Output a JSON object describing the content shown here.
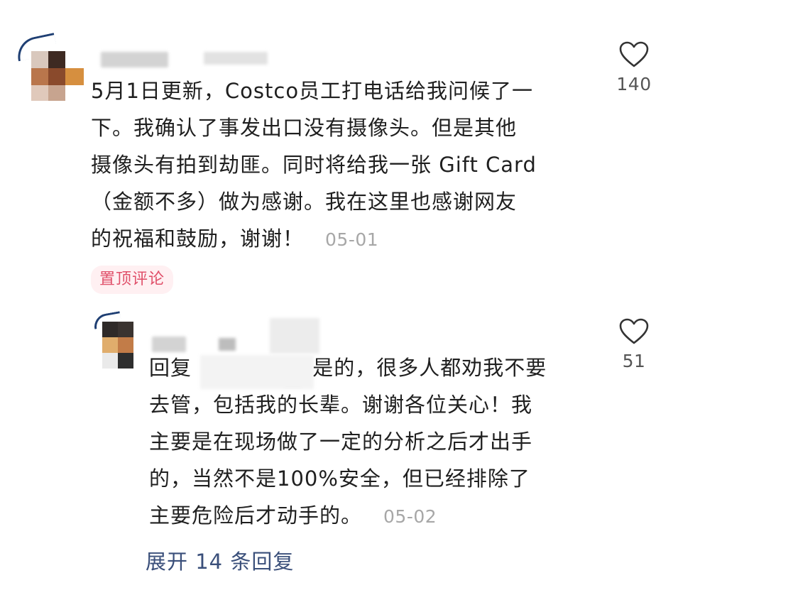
{
  "main_comment": {
    "lines": [
      "5月1日更新，Costco员工打电话给我问候了一",
      "下。我确认了事发出口没有摄像头。但是其他",
      "摄像头有拍到劫匪。同时将给我一张 Gift Card",
      "（金额不多）做为感谢。我在这里也感谢网友",
      "的祝福和鼓励，谢谢！"
    ],
    "timestamp": "05-01",
    "pinned_label": "置顶评论",
    "like_count": "140"
  },
  "reply": {
    "lines": [
      "回复 ",
      "去管，包括我的长辈。谢谢各位关心！我",
      "主要是在现场做了一定的分析之后才出手",
      "的，当然不是100%安全，但已经排除了",
      "主要危险后才动手的。"
    ],
    "line1_rest": "是的，很多人都劝我不要",
    "timestamp": "05-02",
    "like_count": "51"
  },
  "expand_replies_label": "展开 14 条回复",
  "colors": {
    "pinned_bg": "#fff0f2",
    "pinned_text": "#e0506a",
    "link_text": "#3a4f7a",
    "timestamp": "#a7a7a7"
  },
  "icons": {
    "like": "heart-outline-icon"
  }
}
